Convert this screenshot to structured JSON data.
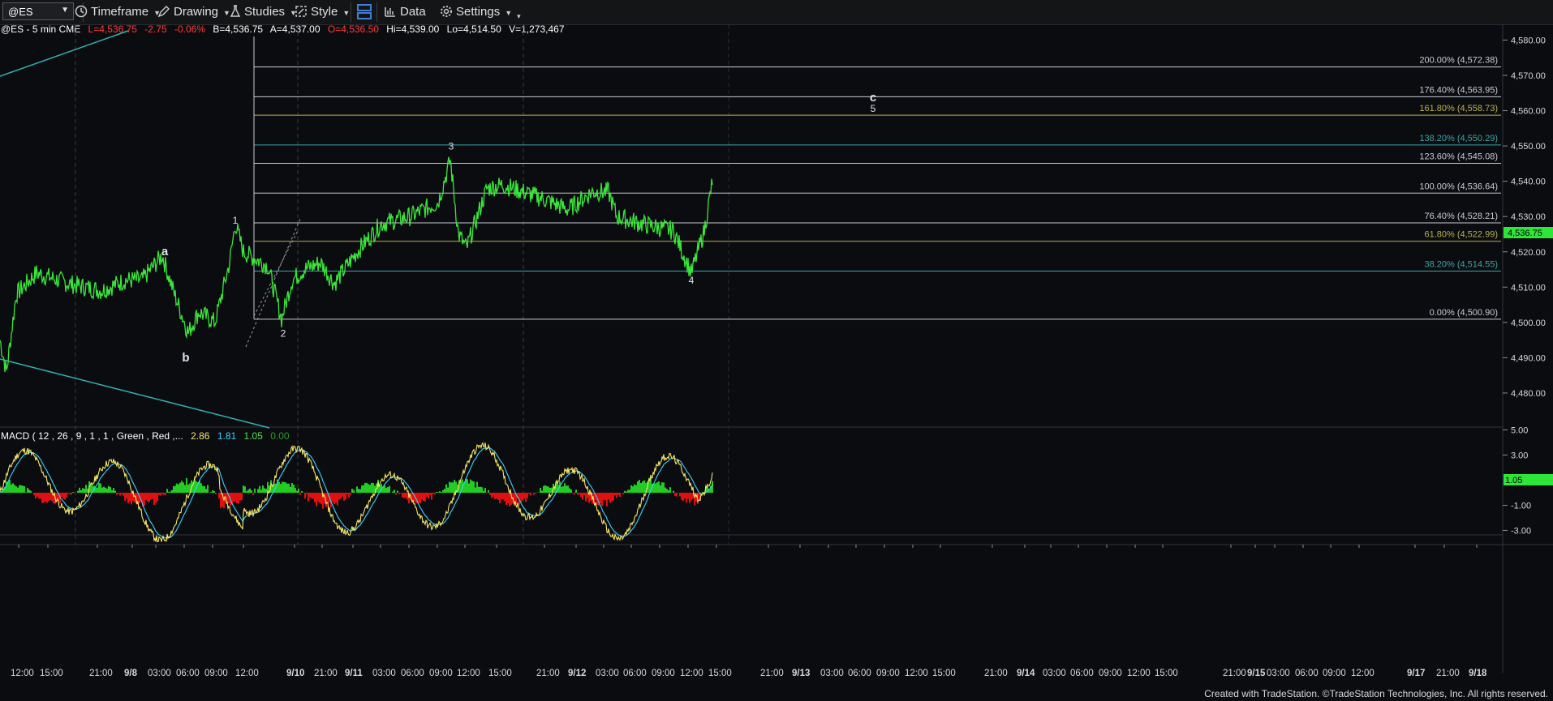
{
  "toolbar": {
    "symbol": "@ES",
    "items": [
      {
        "id": "timeframe",
        "label": "Timeframe"
      },
      {
        "id": "drawing",
        "label": "Drawing"
      },
      {
        "id": "studies",
        "label": "Studies"
      },
      {
        "id": "style",
        "label": "Style"
      },
      {
        "id": "data",
        "label": "Data"
      },
      {
        "id": "settings",
        "label": "Settings"
      }
    ]
  },
  "header": {
    "instrument": "@ES - 5 min  CME",
    "last": "L=4,536.75",
    "change": "-2.75",
    "pct": "-0.06%",
    "bid": "B=4,536.75",
    "ask": "A=4,537.00",
    "open": "O=4,536.50",
    "high": "Hi=4,539.00",
    "low": "Lo=4,514.50",
    "volume": "V=1,273,467"
  },
  "price_axis": {
    "ticks": [
      "4,580.00",
      "4,570.00",
      "4,560.00",
      "4,550.00",
      "4,540.00",
      "4,530.00",
      "4,520.00",
      "4,510.00",
      "4,500.00",
      "4,490.00",
      "4,480.00"
    ],
    "current_price": "4,536.75"
  },
  "fib_levels": [
    {
      "label": "200.00% (4,572.38)",
      "price": 4572.38,
      "color": "#c8ccd4"
    },
    {
      "label": "176.40% (4,563.95)",
      "price": 4563.95,
      "color": "#c8ccd4"
    },
    {
      "label": "161.80% (4,558.73)",
      "price": 4558.73,
      "color": "#b9b24a"
    },
    {
      "label": "138.20% (4,550.29)",
      "price": 4550.29,
      "color": "#3aa6a6"
    },
    {
      "label": "123.60% (4,545.08)",
      "price": 4545.08,
      "color": "#c8ccd4"
    },
    {
      "label": "100.00% (4,536.64)",
      "price": 4536.64,
      "color": "#c8ccd4"
    },
    {
      "label": "76.40% (4,528.21)",
      "price": 4528.21,
      "color": "#c8ccd4"
    },
    {
      "label": "61.80% (4,522.99)",
      "price": 4522.99,
      "color": "#b9b24a"
    },
    {
      "label": "38.20% (4,514.55)",
      "price": 4514.55,
      "color": "#3aa6a6"
    },
    {
      "label": "0.00% (4,500.90)",
      "price": 4500.9,
      "color": "#c8ccd4"
    }
  ],
  "wave_labels": [
    {
      "text": "a",
      "price": 4519
    },
    {
      "text": "b",
      "price": 4489
    },
    {
      "text": "1",
      "price": 4528
    },
    {
      "text": "2",
      "price": 4496
    },
    {
      "text": "3",
      "price": 4549
    },
    {
      "text": "4",
      "price": 4511
    },
    {
      "text": "c",
      "price": 4564
    },
    {
      "text": "5",
      "price": 4560
    }
  ],
  "macd": {
    "title": "MACD ( 12 , 26 , 9 , 1 , 1 , Green , Red ,...",
    "v1": "2.86",
    "v2": "1.81",
    "v3": "1.05",
    "v4": "0.00",
    "ticks": [
      "5.00",
      "3.00",
      "1.05",
      "-1.00",
      "-3.00"
    ]
  },
  "time_axis": [
    "12:00",
    "15:00",
    "21:00",
    "9/8",
    "03:00",
    "06:00",
    "09:00",
    "12:00",
    "9/10",
    "21:00",
    "9/11",
    "03:00",
    "06:00",
    "09:00",
    "12:00",
    "15:00",
    "21:00",
    "9/12",
    "03:00",
    "06:00",
    "09:00",
    "12:00",
    "15:00",
    "21:00",
    "9/13",
    "03:00",
    "06:00",
    "09:00",
    "12:00",
    "15:00",
    "21:00",
    "9/14",
    "03:00",
    "06:00",
    "09:00",
    "12:00",
    "15:00",
    "21:00",
    "9/15",
    "03:00",
    "06:00",
    "09:00",
    "12:00",
    "9/17",
    "21:00",
    "9/18"
  ],
  "footer": "Created with TradeStation. ©TradeStation Technologies, Inc. All rights reserved.",
  "colors": {
    "price": "#39e639",
    "macd_pos": "#22cc22",
    "macd_neg": "#e01010",
    "trend": "#2fb4b4"
  }
}
